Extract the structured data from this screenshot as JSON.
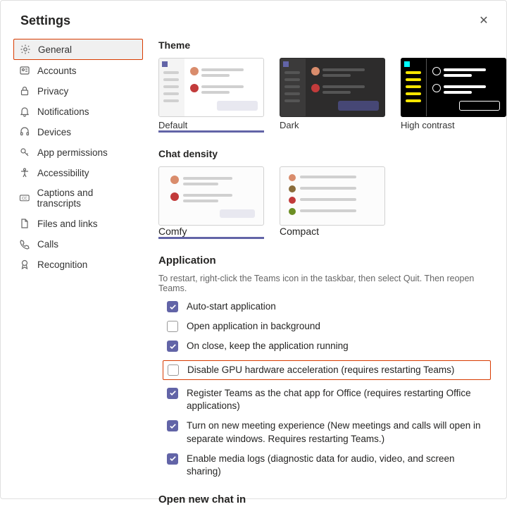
{
  "header": {
    "title": "Settings"
  },
  "sidebar": {
    "items": [
      {
        "label": "General"
      },
      {
        "label": "Accounts"
      },
      {
        "label": "Privacy"
      },
      {
        "label": "Notifications"
      },
      {
        "label": "Devices"
      },
      {
        "label": "App permissions"
      },
      {
        "label": "Accessibility"
      },
      {
        "label": "Captions and transcripts"
      },
      {
        "label": "Files and links"
      },
      {
        "label": "Calls"
      },
      {
        "label": "Recognition"
      }
    ],
    "selected_index": 0
  },
  "theme": {
    "title": "Theme",
    "options": [
      {
        "label": "Default"
      },
      {
        "label": "Dark"
      },
      {
        "label": "High contrast"
      }
    ],
    "selected_index": 0
  },
  "density": {
    "title": "Chat density",
    "options": [
      {
        "label": "Comfy"
      },
      {
        "label": "Compact"
      }
    ],
    "selected_index": 0
  },
  "application": {
    "title": "Application",
    "hint": "To restart, right-click the Teams icon in the taskbar, then select Quit. Then reopen Teams.",
    "items": [
      {
        "checked": true,
        "label": "Auto-start application"
      },
      {
        "checked": false,
        "label": "Open application in background"
      },
      {
        "checked": true,
        "label": "On close, keep the application running"
      },
      {
        "checked": false,
        "label": "Disable GPU hardware acceleration (requires restarting Teams)",
        "highlight": true
      },
      {
        "checked": true,
        "label": "Register Teams as the chat app for Office (requires restarting Office applications)"
      },
      {
        "checked": true,
        "label": "Turn on new meeting experience (New meetings and calls will open in separate windows. Requires restarting Teams.)"
      },
      {
        "checked": true,
        "label": "Enable media logs (diagnostic data for audio, video, and screen sharing)"
      }
    ]
  },
  "open_chat": {
    "title": "Open new chat in"
  }
}
